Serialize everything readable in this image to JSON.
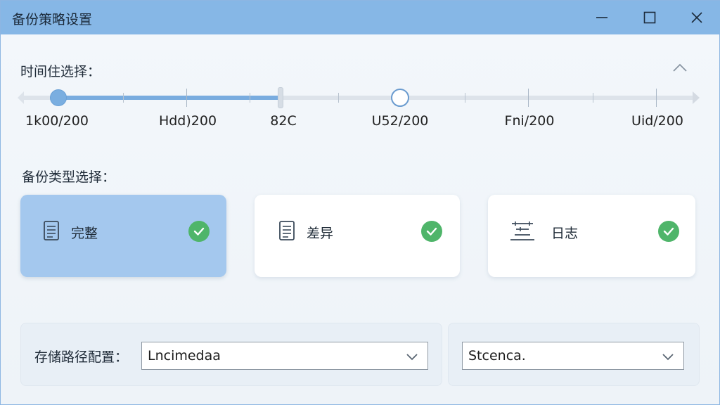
{
  "window": {
    "title": "备份策略设置"
  },
  "time_section": {
    "label": "时间住选择：",
    "progress": 0.4,
    "tick_labels": [
      "1k00/200",
      "Hdd)200",
      "82C",
      "U52/200",
      "Fni/200",
      "Uid/200"
    ]
  },
  "type_section": {
    "label": "备份类型选择：",
    "cards": [
      {
        "label": "完整",
        "icon": "document-icon",
        "selected": true,
        "checked": true
      },
      {
        "label": "差异",
        "icon": "document-icon",
        "selected": false,
        "checked": true
      },
      {
        "label": "日志",
        "icon": "log-lines-icon",
        "selected": false,
        "checked": true
      }
    ]
  },
  "storage": {
    "label": "存储路径配置：",
    "path_value": "Lncimedaa",
    "secondary_value": "Stcenca."
  },
  "colors": {
    "accent": "#79acdf",
    "check": "#4fb56a",
    "titlebar": "#86b7e6"
  }
}
